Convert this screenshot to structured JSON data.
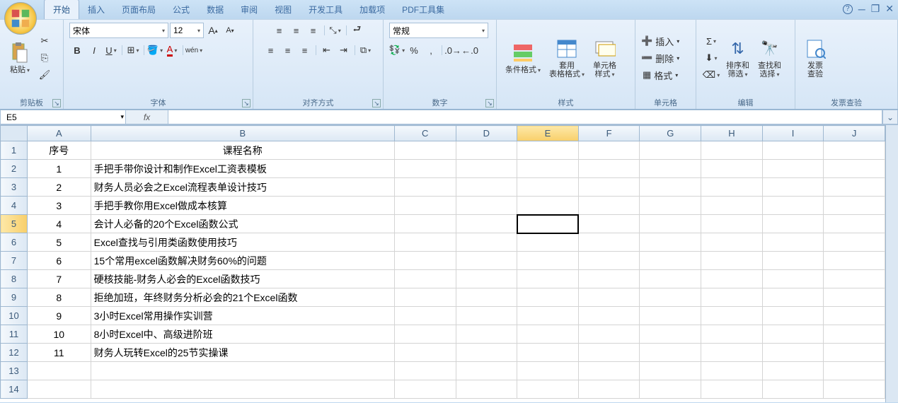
{
  "tabs": [
    "开始",
    "插入",
    "页面布局",
    "公式",
    "数据",
    "审阅",
    "视图",
    "开发工具",
    "加载项",
    "PDF工具集"
  ],
  "activeTab": 0,
  "helpIcon": "?",
  "groups": {
    "clipboard": {
      "label": "剪贴板",
      "paste": "粘贴"
    },
    "font": {
      "label": "字体",
      "name": "宋体",
      "size": "12"
    },
    "align": {
      "label": "对齐方式"
    },
    "number": {
      "label": "数字",
      "format": "常规"
    },
    "styles": {
      "label": "样式",
      "cond": "条件格式",
      "tbl": "套用\n表格格式",
      "cell": "单元格\n样式"
    },
    "cells": {
      "label": "单元格",
      "insert": "插入",
      "delete": "删除",
      "format": "格式"
    },
    "editing": {
      "label": "编辑",
      "sort": "排序和\n筛选",
      "find": "查找和\n选择"
    },
    "invoice": {
      "label": "发票查验",
      "btn": "发票\n查验"
    }
  },
  "nameBox": "E5",
  "headers": {
    "A": "序号",
    "B": "课程名称"
  },
  "columns": [
    "A",
    "B",
    "C",
    "D",
    "E",
    "F",
    "G",
    "H",
    "I",
    "J"
  ],
  "rows": [
    {
      "n": 1,
      "a": "序号",
      "b": "课程名称",
      "isHeader": true
    },
    {
      "n": 2,
      "a": "1",
      "b": "手把手带你设计和制作Excel工资表模板"
    },
    {
      "n": 3,
      "a": "2",
      "b": "财务人员必会之Excel流程表单设计技巧"
    },
    {
      "n": 4,
      "a": "3",
      "b": "手把手教你用Excel做成本核算"
    },
    {
      "n": 5,
      "a": "4",
      "b": "会计人必备的20个Excel函数公式"
    },
    {
      "n": 6,
      "a": "5",
      "b": "Excel查找与引用类函数使用技巧"
    },
    {
      "n": 7,
      "a": "6",
      "b": "15个常用excel函数解决财务60%的问题"
    },
    {
      "n": 8,
      "a": "7",
      "b": "硬核技能-财务人必会的Excel函数技巧"
    },
    {
      "n": 9,
      "a": "8",
      "b": "拒绝加班，年终财务分析必会的21个Excel函数"
    },
    {
      "n": 10,
      "a": "9",
      "b": "3小时Excel常用操作实训营"
    },
    {
      "n": 11,
      "a": "10",
      "b": "8小时Excel中、高级进阶班"
    },
    {
      "n": 12,
      "a": "11",
      "b": "财务人玩转Excel的25节实操课"
    },
    {
      "n": 13,
      "a": "",
      "b": ""
    },
    {
      "n": 14,
      "a": "",
      "b": ""
    }
  ],
  "activeCell": {
    "row": 5,
    "col": "E"
  }
}
